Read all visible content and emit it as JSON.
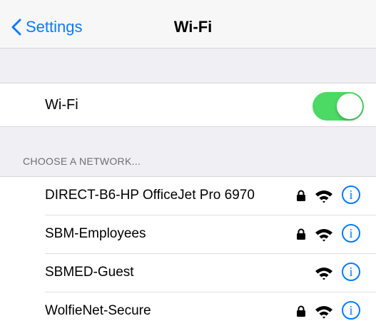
{
  "nav": {
    "back_label": "Settings",
    "title": "Wi-Fi"
  },
  "wifi": {
    "label": "Wi-Fi",
    "enabled": true
  },
  "section": {
    "header": "CHOOSE A NETWORK..."
  },
  "networks": [
    {
      "name": "DIRECT-B6-HP OfficeJet Pro 6970",
      "secured": true
    },
    {
      "name": "SBM-Employees",
      "secured": true
    },
    {
      "name": "SBMED-Guest",
      "secured": false
    },
    {
      "name": "WolfieNet-Secure",
      "secured": true
    }
  ],
  "icons": {
    "info_glyph": "i"
  },
  "colors": {
    "accent": "#0a7aff",
    "toggle_on": "#4cd964",
    "group_bg": "#efeff4",
    "section_text": "#6d6d72"
  }
}
